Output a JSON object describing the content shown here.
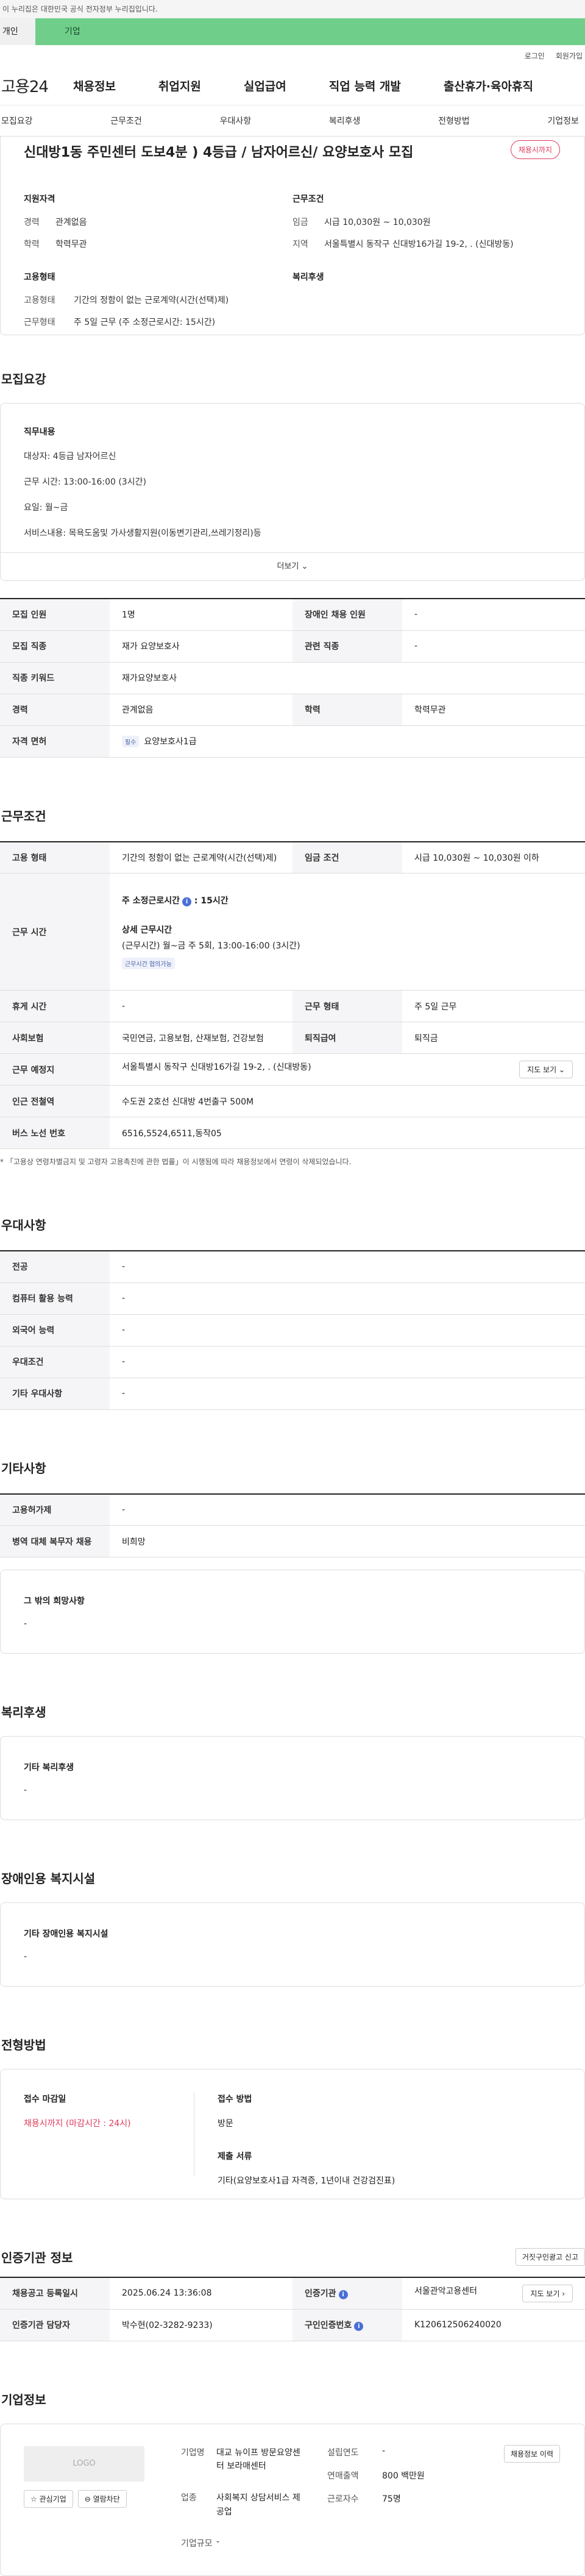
{
  "gov_notice": "이 누리집은 대한민국 공식 전자정부 누리집입니다.",
  "tabs": {
    "individual": "개인",
    "business": "기업"
  },
  "util": {
    "login": "로그인",
    "signup": "회원가입"
  },
  "logo": "고용24",
  "gnb": [
    "채용정보",
    "취업지원",
    "실업급여",
    "직업 능력 개발",
    "출산휴가·육아휴직"
  ],
  "subnav": [
    "모집요강",
    "근무조건",
    "우대사항",
    "복리후생",
    "전형방법",
    "기업정보"
  ],
  "header": {
    "title": "신대방1동 주민센터 도보4분 ) 4등급 / 남자어르신/ 요양보호사 모집",
    "badge": "채용시까지",
    "qual_heading": "지원자격",
    "career_k": "경력",
    "career_v": "관계없음",
    "edu_k": "학력",
    "edu_v": "학력무관",
    "work_heading": "근무조건",
    "wage_k": "임금",
    "wage_v": "시급 10,030원 ~ 10,030원",
    "region_k": "지역",
    "region_v": "서울특별시 동작구 신대방16가길 19-2, . (신대방동)",
    "emp_heading": "고용형태",
    "emp_k": "고용형태",
    "emp_v": "기간의 정함이 없는 근로계약(시간(선택)제)",
    "worktype_k": "근무형태",
    "worktype_v": "주 5일 근무 (주 소정근로시간: 15시간)",
    "welfare_heading": "복리후생"
  },
  "recruit": {
    "section": "모집요강",
    "duty_heading": "직무내용",
    "duty_lines": [
      "대상자: 4등급 남자어르신",
      "근무 시간: 13:00-16:00 (3시간)",
      "요일: 월~금",
      "서비스내용: 목욕도움및 가사생활지원(이동변기관리,쓰레기정리)등"
    ],
    "more": "더보기 ⌄",
    "rows": [
      [
        "모집 인원",
        "1명",
        "장애인 채용 인원",
        "-"
      ],
      [
        "모집 직종",
        "재가 요양보호사",
        "관련 직종",
        "-"
      ],
      [
        "직종 키워드",
        "재가요양보호사",
        "",
        ""
      ],
      [
        "경력",
        "관계없음",
        "학력",
        "학력무관"
      ]
    ],
    "license_k": "자격 면허",
    "license_tag": "필수",
    "license_v": "요양보호사1급"
  },
  "conditions": {
    "section": "근무조건",
    "emp_k": "고용 형태",
    "emp_v": "기간의 정함이 없는 근로계약(시간(선택)제)",
    "wage_k": "임금 조건",
    "wage_v": "시급 10,030원 ~ 10,030원 이하",
    "hours_k": "근무 시간",
    "hours_main": "주 소정근로시간",
    "hours_main_val": ": 15시간",
    "hours_detail_h": "상세 근무시간",
    "hours_detail": "(근무시간) 월~금 주 5회, 13:00-16:00 (3시간)",
    "hours_tag": "근무시간 협의가능",
    "break_k": "휴게 시간",
    "break_v": "-",
    "type_k": "근무 형태",
    "type_v": "주 5일 근무",
    "ins_k": "사회보험",
    "ins_v": "국민연금, 고용보험, 산재보험, 건강보험",
    "sev_k": "퇴직급여",
    "sev_v": "퇴직금",
    "place_k": "근무 예정지",
    "place_v": "서울특별시 동작구 신대방16가길 19-2, . (신대방동)",
    "map_btn": "지도 보기 ⌄",
    "subway_k": "인근 전철역",
    "subway_v": "수도권 2호선 신대방 4번출구 500M",
    "bus_k": "버스 노선 번호",
    "bus_v": "6516,5524,6511,동작05",
    "note": "* 「고용상 연령차별금지 및 고령자 고용촉진에 관한 법률」이 시행됨에 따라 채용정보에서 연령이 삭제되었습니다."
  },
  "preference": {
    "section": "우대사항",
    "rows": [
      [
        "전공",
        "-"
      ],
      [
        "컴퓨터 활용 능력",
        "-"
      ],
      [
        "외국어 능력",
        "-"
      ],
      [
        "우대조건",
        "-"
      ],
      [
        "기타 우대사항",
        "-"
      ]
    ]
  },
  "etc": {
    "section": "기타사항",
    "rows": [
      [
        "고용허가제",
        "-"
      ],
      [
        "병역 대체 복무자 채용",
        "비희망"
      ]
    ],
    "wish_h": "그 밖의 희망사항",
    "wish_v": "-"
  },
  "welfare": {
    "section": "복리후생",
    "h": "기타 복리후생",
    "v": "-"
  },
  "disabled": {
    "section": "장애인용 복지시설",
    "h": "기타 장애인용 복지시설",
    "v": "-"
  },
  "selection": {
    "section": "전형방법",
    "deadline_h": "접수 마감일",
    "deadline_v": "채용시까지 (마감시간 : 24시)",
    "method_h": "접수 방법",
    "method_v": "방문",
    "docs_h": "제출 서류",
    "docs_v": "기타(요양보호사1급 자격증, 1년이내 건강검진표)"
  },
  "agency": {
    "section": "인증기관 정보",
    "report_btn": "거짓구인광고 신고",
    "reg_k": "채용공고 등록일시",
    "reg_v": "2025.06.24 13:36:08",
    "org_k": "인증기관",
    "org_v": "서울관악고용센터",
    "map_btn": "지도 보기 ›",
    "manager_k": "인증기관 담당자",
    "manager_v": "박수현(02-3282-9233)",
    "cert_k": "구인인증번호",
    "cert_v": "K120612506240020"
  },
  "company": {
    "section": "기업정보",
    "logo_text": "LOGO",
    "fav_btn": "☆ 관심기업",
    "block_btn": "⊖ 열람차단",
    "history_btn": "채용정보 이력",
    "name_k": "기업명",
    "name_v": "대교 뉴이프 방문요양센터 보라매센터",
    "year_k": "설립연도",
    "year_v": "-",
    "sales_k": "연매출액",
    "sales_v": "800 백만원",
    "industry_k": "업종",
    "industry_v": "사회복지 상담서비스 제공업",
    "emp_k": "근로자수",
    "emp_v": "75명",
    "size_k": "기업규모",
    "size_v": "-"
  }
}
